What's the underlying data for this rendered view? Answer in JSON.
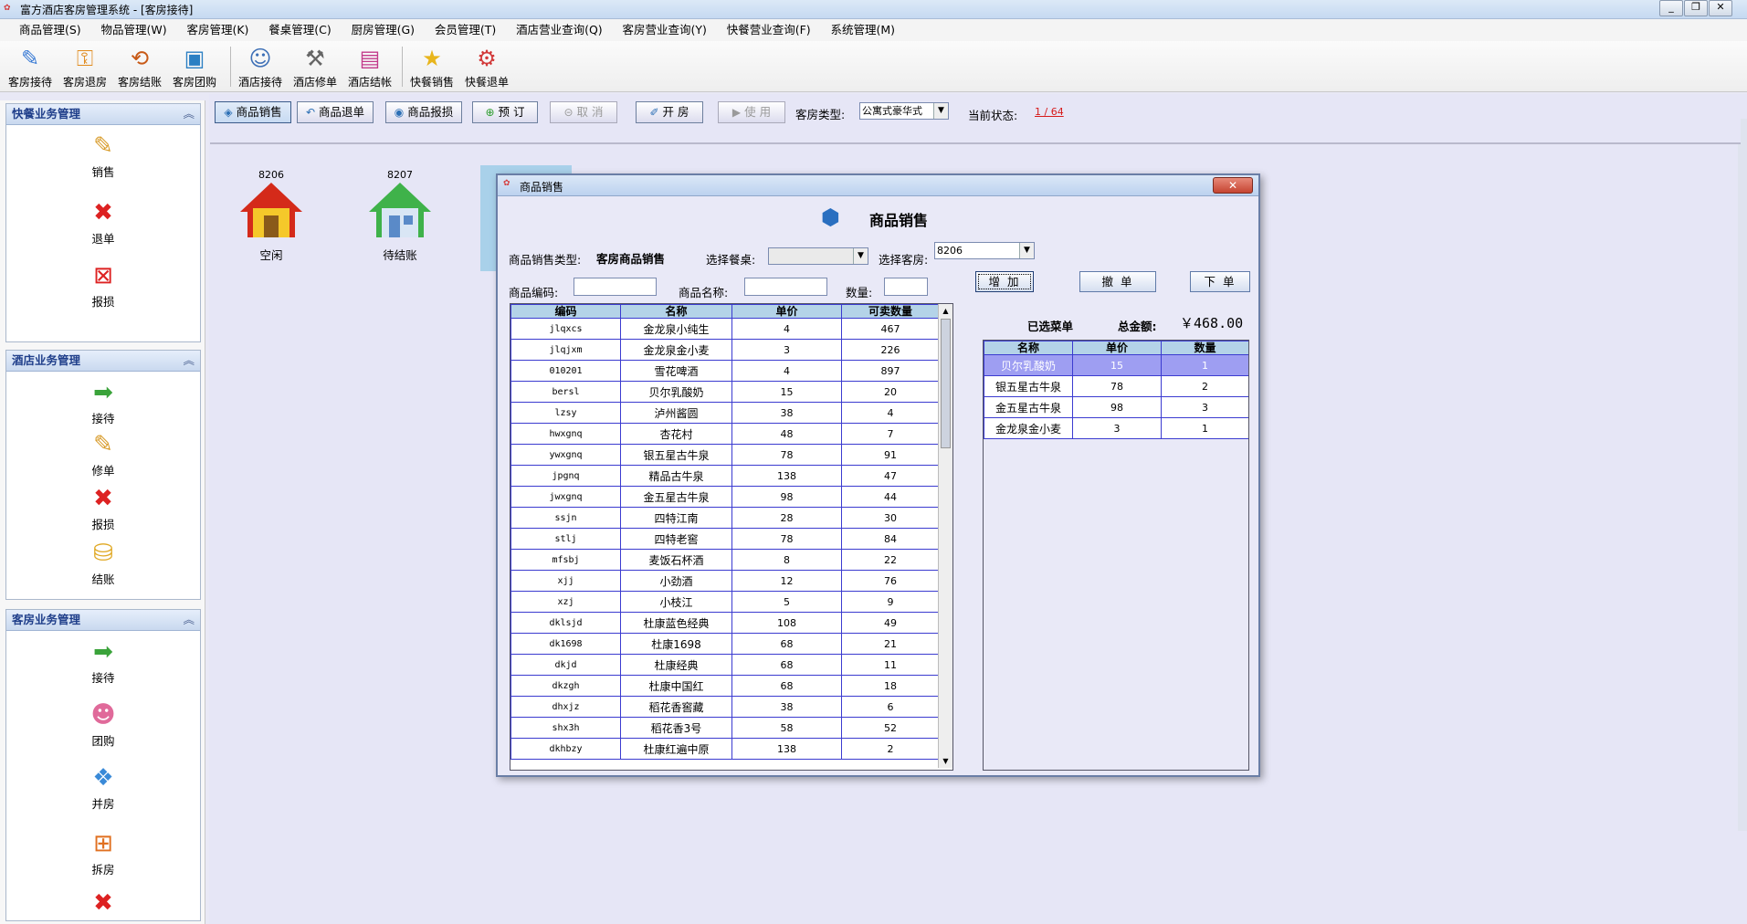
{
  "window": {
    "title": "富方酒店客房管理系统 - [客房接待]"
  },
  "menu": [
    "商品管理(S)",
    "物品管理(W)",
    "客房管理(K)",
    "餐桌管理(C)",
    "厨房管理(G)",
    "会员管理(T)",
    "酒店营业查询(Q)",
    "客房营业查询(Y)",
    "快餐营业查询(F)",
    "系统管理(M)"
  ],
  "toolbar": [
    {
      "label": "客房接待",
      "icon": "pen-icon"
    },
    {
      "label": "客房退房",
      "icon": "key-icon"
    },
    {
      "label": "客房结账",
      "icon": "checkout-icon"
    },
    {
      "label": "客房团购",
      "icon": "group-icon"
    },
    {
      "label": "酒店接待",
      "icon": "reception-icon"
    },
    {
      "label": "酒店修单",
      "icon": "tools-icon"
    },
    {
      "label": "酒店结帐",
      "icon": "bill-icon"
    },
    {
      "label": "快餐销售",
      "icon": "star-icon"
    },
    {
      "label": "快餐退单",
      "icon": "gear-icon"
    }
  ],
  "sidebar": {
    "fastfood": {
      "title": "快餐业务管理",
      "items": [
        "销售",
        "退单",
        "报损"
      ]
    },
    "hotel": {
      "title": "酒店业务管理",
      "items": [
        "接待",
        "修单",
        "报损",
        "结账"
      ]
    },
    "room": {
      "title": "客房业务管理",
      "items": [
        "接待",
        "团购",
        "并房",
        "拆房"
      ]
    }
  },
  "actionbar": {
    "buttons": [
      "商品销售",
      "商品退单",
      "商品报损",
      "预 订",
      "取 消",
      "开 房",
      "使 用"
    ],
    "room_type_label": "客房类型:",
    "room_type_value": "公寓式豪华式",
    "status_label": "当前状态:",
    "status_value": "1 / 64"
  },
  "rooms": [
    {
      "number": "8206",
      "status": "空闲"
    },
    {
      "number": "8207",
      "status": "待结账"
    }
  ],
  "dialog": {
    "window_title": "商品销售",
    "heading": "商品销售",
    "sale_type_label": "商品销售类型:",
    "sale_type_value": "客房商品销售",
    "table_label": "选择餐桌:",
    "table_value": "",
    "room_label": "选择客房:",
    "room_value": "8206",
    "code_label": "商品编码:",
    "name_label": "商品名称:",
    "qty_label": "数量:",
    "add_button": "增 加",
    "remove_button": "撤 单",
    "order_button": "下 单",
    "selected_label": "已选菜单",
    "total_label": "总金额:",
    "total_value": "￥468.00",
    "goods_columns": [
      "编码",
      "名称",
      "单价",
      "可卖数量"
    ],
    "goods": [
      [
        "jlqxcs",
        "金龙泉小纯生",
        "4",
        "467"
      ],
      [
        "jlqjxm",
        "金龙泉金小麦",
        "3",
        "226"
      ],
      [
        "010201",
        "雪花啤酒",
        "4",
        "897"
      ],
      [
        "bersl",
        "贝尔乳酸奶",
        "15",
        "20"
      ],
      [
        "lzsy",
        "泸州酱圆",
        "38",
        "4"
      ],
      [
        "hwxgnq",
        "杏花村",
        "48",
        "7"
      ],
      [
        "ywxgnq",
        "银五星古牛泉",
        "78",
        "91"
      ],
      [
        "jpgnq",
        "精品古牛泉",
        "138",
        "47"
      ],
      [
        "jwxgnq",
        "金五星古牛泉",
        "98",
        "44"
      ],
      [
        "ssjn",
        "四特江南",
        "28",
        "30"
      ],
      [
        "stlj",
        "四特老窖",
        "78",
        "84"
      ],
      [
        "mfsbj",
        "麦饭石杯酒",
        "8",
        "22"
      ],
      [
        "xjj",
        "小劲酒",
        "12",
        "76"
      ],
      [
        "xzj",
        "小枝江",
        "5",
        "9"
      ],
      [
        "dklsjd",
        "杜康蓝色经典",
        "108",
        "49"
      ],
      [
        "dk1698",
        "杜康1698",
        "68",
        "21"
      ],
      [
        "dkjd",
        "杜康经典",
        "68",
        "11"
      ],
      [
        "dkzgh",
        "杜康中国红",
        "68",
        "18"
      ],
      [
        "dhxjz",
        "稻花香窖藏",
        "38",
        "6"
      ],
      [
        "shx3h",
        "稻花香3号",
        "58",
        "52"
      ],
      [
        "dkhbzy",
        "杜康红遍中原",
        "138",
        "2"
      ]
    ],
    "selected_columns": [
      "名称",
      "单价",
      "数量"
    ],
    "selected": [
      [
        "贝尔乳酸奶",
        "15",
        "1"
      ],
      [
        "银五星古牛泉",
        "78",
        "2"
      ],
      [
        "金五星古牛泉",
        "98",
        "3"
      ],
      [
        "金龙泉金小麦",
        "3",
        "1"
      ]
    ]
  }
}
